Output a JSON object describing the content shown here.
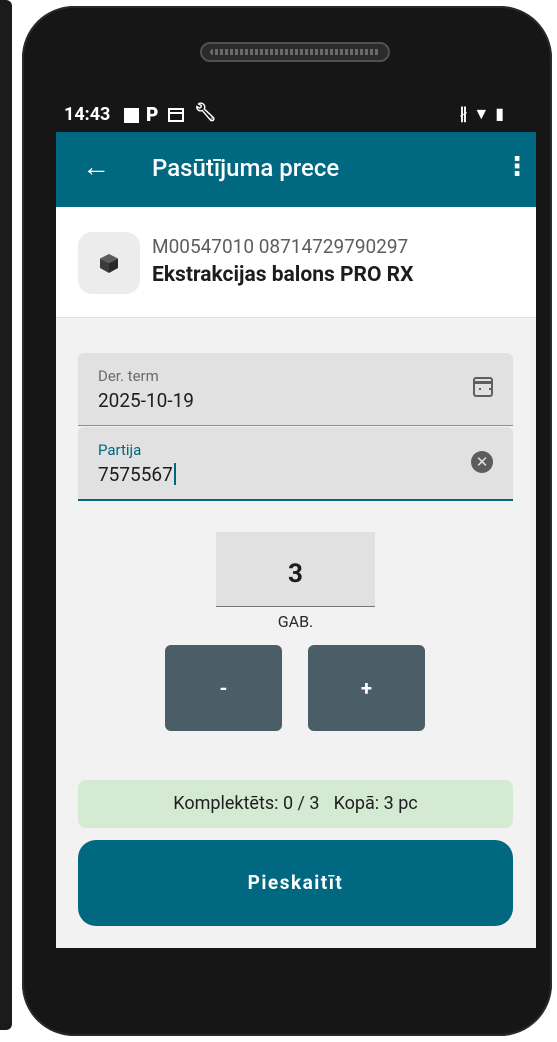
{
  "status_bar": {
    "time": "14:43",
    "icons": [
      "square-notification-icon",
      "parking-icon",
      "calendar-icon",
      "wrench-icon"
    ],
    "right_icons": [
      "bluetooth-icon",
      "wifi-icon",
      "battery-icon"
    ]
  },
  "app_bar": {
    "title": "Pasūtījuma prece",
    "back_icon": "arrow-back-icon",
    "menu_icon": "more-vert-icon",
    "color": "#006880"
  },
  "product": {
    "code": "M00547010 08714729790297",
    "name": "Ekstrakcijas balons PRO RX",
    "icon": "cube-icon"
  },
  "fields": {
    "term_label": "Der. term",
    "term_value": "2025-10-19",
    "partija_label": "Partija",
    "partija_value": "7575567"
  },
  "quantity": {
    "value": "3",
    "unit": "GAB."
  },
  "stepper": {
    "minus_label": "-",
    "plus_label": "+"
  },
  "summary": {
    "completed": "Komplektēts: 0 / 3",
    "total": "Kopā: 3 pc",
    "color": "#d5ead3"
  },
  "submit_label": "Pieskaitīt"
}
